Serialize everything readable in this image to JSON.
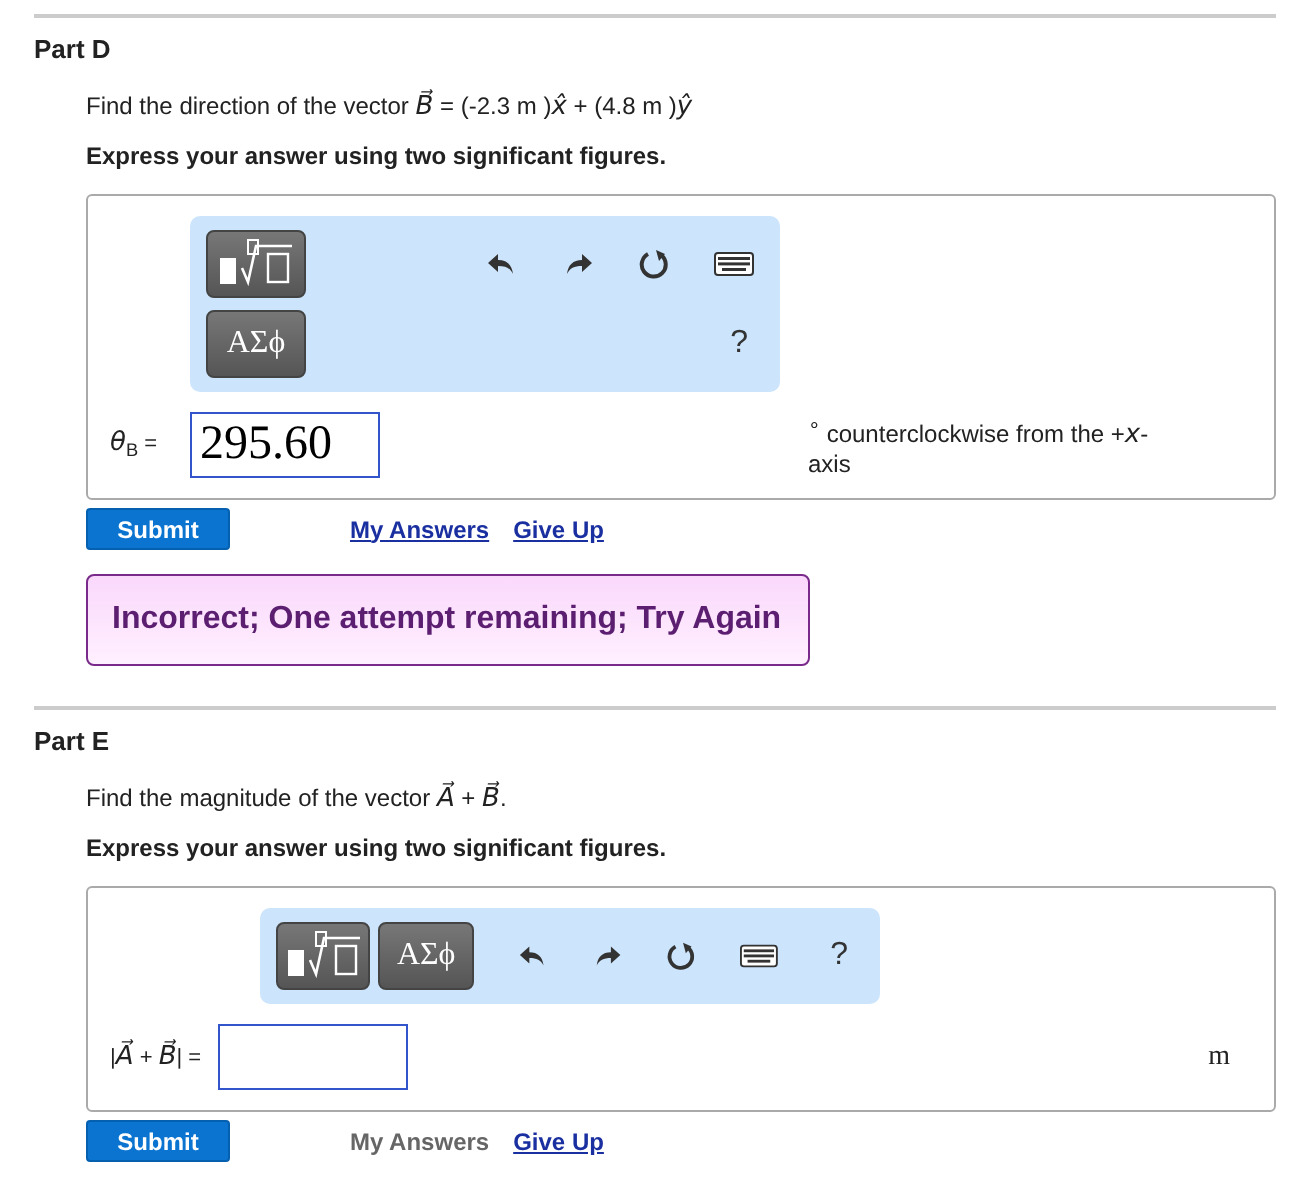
{
  "parts": [
    {
      "title": "Part D",
      "prompt": "Find the direction of the vector *B⃗* = (-2.3 m )*x̂* + (4.8 m )*ŷ*",
      "instruction": "Express your answer using two significant figures.",
      "toolbar": {
        "kind": "stacked",
        "greek": "ΑΣϕ",
        "help": "?"
      },
      "answer_label": "*θ*$_{B}$ =",
      "answer_value": "295.60",
      "unit": "$^{∘}$ counterclockwise from the +*x*-axis",
      "submit": "Submit",
      "my_answers": {
        "label": "My Answers",
        "disabled": false
      },
      "give_up": "Give Up",
      "feedback": "Incorrect; One attempt remaining; Try Again"
    },
    {
      "title": "Part E",
      "prompt": "Find the magnitude of the vector *A⃗* + *B⃗*.",
      "instruction": "Express your answer using two significant figures.",
      "toolbar": {
        "kind": "inline",
        "greek": "ΑΣϕ",
        "help": "?"
      },
      "answer_label": "|*A⃗* + *B⃗*| =",
      "unit": "m",
      "submit": "Submit",
      "my_answers": {
        "label": "My Answers",
        "disabled": true
      },
      "give_up": "Give Up"
    }
  ]
}
